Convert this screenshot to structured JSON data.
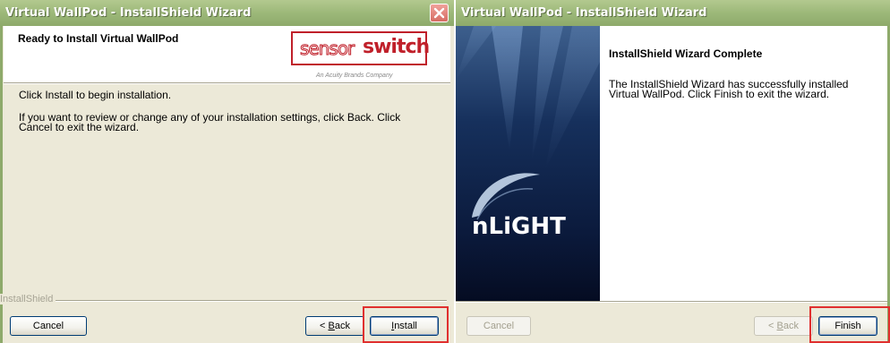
{
  "left_window": {
    "title": "Virtual WallPod - InstallShield Wizard",
    "header_title": "Ready to Install Virtual WallPod",
    "logo": {
      "part1": "sensor",
      "part2": "switch",
      "tagline": "An Acuity Brands Company"
    },
    "line1": "Click Install to begin installation.",
    "line2": "If you want to review or change any of your installation settings, click Back. Click Cancel to exit the wizard.",
    "brand_label": "InstallShield",
    "buttons": {
      "cancel": "Cancel",
      "back_mn": "B",
      "back_rest": "ack",
      "install_mn": "I",
      "install_rest": "nstall"
    },
    "highlight_color": "#e0302f"
  },
  "right_window": {
    "title": "Virtual WallPod - InstallShield Wizard",
    "side_logo": "nLiGHT",
    "heading": "InstallShield Wizard Complete",
    "message": "The InstallShield Wizard has successfully installed Virtual WallPod.  Click Finish to exit the wizard.",
    "buttons": {
      "cancel": "Cancel",
      "back_mn": "B",
      "back_rest": "ack",
      "finish": "Finish"
    },
    "highlight_color": "#e0302f"
  },
  "colors": {
    "titlebar": "#9cb879",
    "dialog_bg": "#ece9d8",
    "accent_red": "#c0202a",
    "side_panel_dark": "#0b1a3c"
  },
  "icons": [
    "close-icon",
    "swoosh-icon"
  ]
}
